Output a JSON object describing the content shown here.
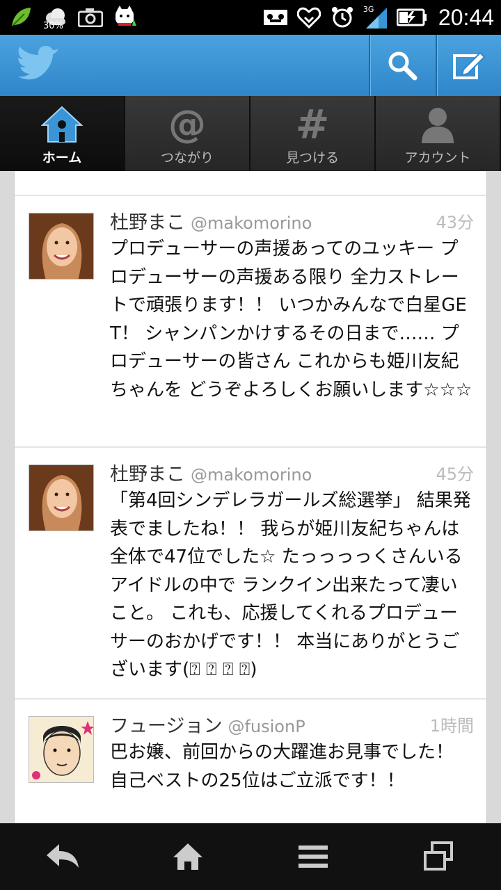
{
  "status_bar": {
    "battery_percent": "30%",
    "network": "3G",
    "time": "20:44"
  },
  "tabs": [
    {
      "label": "ホーム",
      "icon": "home-icon",
      "active": true
    },
    {
      "label": "つながり",
      "icon": "at-icon",
      "active": false
    },
    {
      "label": "見つける",
      "icon": "hashtag-icon",
      "active": false
    },
    {
      "label": "アカウント",
      "icon": "account-icon",
      "active": false
    }
  ],
  "tweets": [
    {
      "name": "杜野まこ",
      "handle": "@makomorino",
      "time": "43分",
      "text": "プロデューサーの声援あってのユッキー プロデューサーの声援ある限り 全力ストレートで頑張ります！！ いつかみんなで白星GET！ シャンパンかけするその日まで…… プロデューサーの皆さん これからも姫川友紀ちゃんを どうぞよろしくお願いします☆☆☆"
    },
    {
      "name": "杜野まこ",
      "handle": "@makomorino",
      "time": "45分",
      "text": "「第4回シンデレラガールズ総選挙」 結果発表でましたね！！ 我らが姫川友紀ちゃんは 全体で47位でした☆ たっっっっくさんいるアイドルの中で ランクイン出来たって凄いこと。 これも、応援してくれるプロデューサーのおかげです！！ 本当にありがとうございます(⍰ ⍰ ⍰ ⍰)"
    },
    {
      "name": "フュージョン",
      "handle": "@fusionP",
      "time": "1時間",
      "text": "巴お嬢、前回からの大躍進お見事でした！ 自己ベストの25位はご立派です！！"
    }
  ],
  "colors": {
    "action_bar": "#3a95d6",
    "tab_active_icon": "#3a95d6"
  }
}
